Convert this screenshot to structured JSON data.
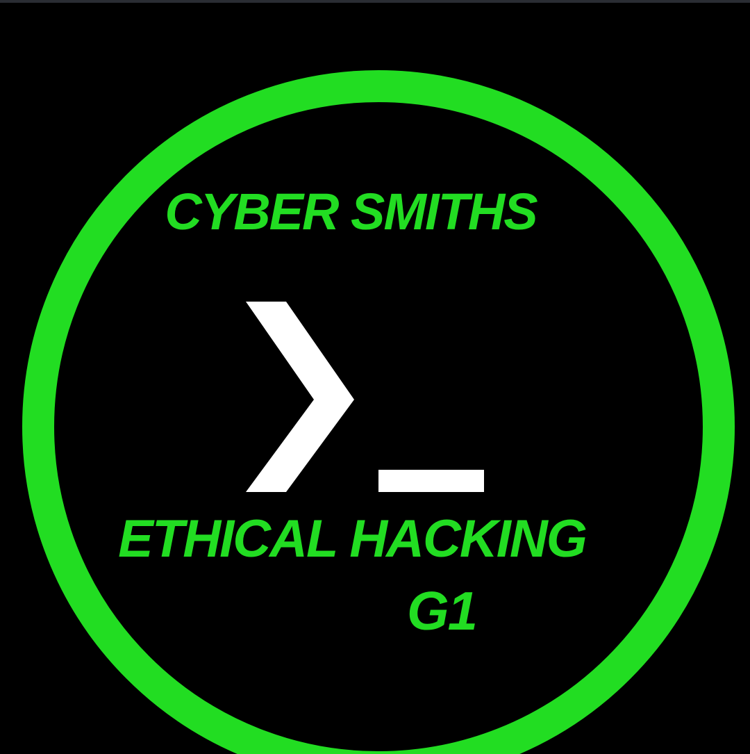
{
  "logo": {
    "line1": "CYBER SMITHS",
    "line2": "ETHICAL HACKING",
    "line3": "G1",
    "icon": "terminal-prompt-icon",
    "colors": {
      "background": "#000000",
      "ring": "#22dd22",
      "text": "#22dd22",
      "prompt": "#ffffff"
    }
  }
}
